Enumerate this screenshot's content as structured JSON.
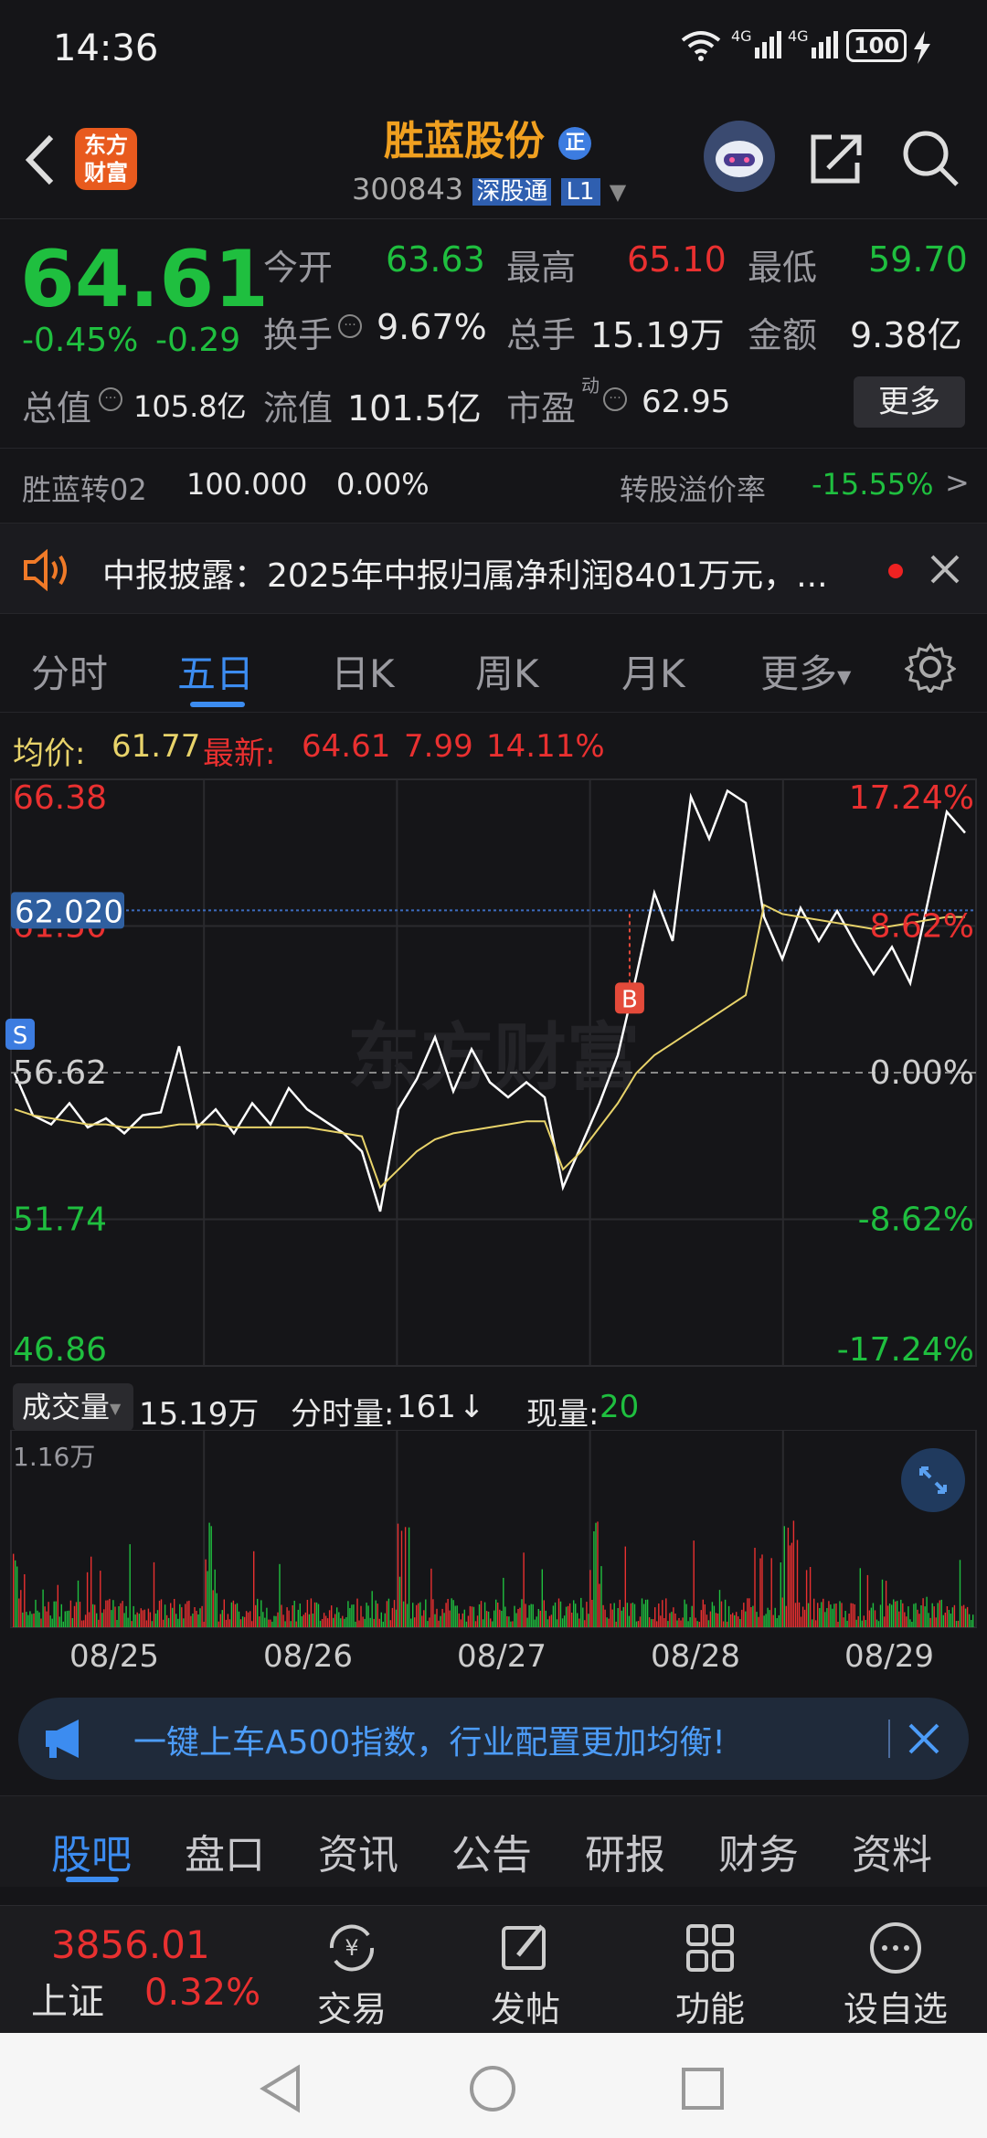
{
  "status": {
    "time": "14:36",
    "net1": "4G",
    "net2": "4G",
    "battery": "100"
  },
  "header": {
    "logo_line1": "东方",
    "logo_line2": "财富",
    "stock_name": "胜蓝股份",
    "name_badge": "正",
    "stock_code": "300843",
    "connect_badge": "深股通",
    "level_badge": "L1"
  },
  "quote": {
    "price": "64.61",
    "change_pct": "-0.45%",
    "change": "-0.29",
    "open_label": "今开",
    "open": "63.63",
    "high_label": "最高",
    "high": "65.10",
    "low_label": "最低",
    "low": "59.70",
    "turnover_label": "换手",
    "turnover": "9.67%",
    "volume_label": "总手",
    "volume": "15.19万",
    "amount_label": "金额",
    "amount": "9.38亿",
    "mktcap_label": "总值",
    "mktcap": "105.8亿",
    "float_label": "流值",
    "float_cap": "101.5亿",
    "pe_label": "市盈",
    "pe_sup": "动",
    "pe": "62.95",
    "more_button": "更多"
  },
  "bond": {
    "name": "胜蓝转02",
    "price": "100.000",
    "change": "0.00%",
    "premium_label": "转股溢价率",
    "premium": "-15.55%",
    "arrow": ">"
  },
  "notice": {
    "text": "中报披露：2025年中报归属净利润8401万元，..."
  },
  "chart_tabs": [
    "分时",
    "五日",
    "日K",
    "周K",
    "月K",
    "更多"
  ],
  "chart_info": {
    "avg_label": "均价:",
    "avg": "61.77",
    "latest_label": "最新:",
    "latest": "64.61",
    "chg": "7.99",
    "chg_pct": "14.11%"
  },
  "chart_data": {
    "type": "line",
    "title": "",
    "y_left_ticks": [
      "66.38",
      "61.50",
      "56.62",
      "51.74",
      "46.86"
    ],
    "y_right_ticks": [
      "17.24%",
      "8.62%",
      "0.00%",
      "-8.62%",
      "-17.24%"
    ],
    "ylim": [
      46.86,
      66.38
    ],
    "crosshair_price": "62.020",
    "baseline": 56.62,
    "markers": [
      {
        "label": "S",
        "day": "08/25"
      },
      {
        "label": "B",
        "day": "08/28"
      }
    ],
    "days": [
      "08/25",
      "08/26",
      "08/27",
      "08/28",
      "08/29"
    ],
    "watermark": "东方财富",
    "series": [
      {
        "name": "price",
        "color": "#ffffff",
        "values": [
          56.6,
          55.2,
          54.9,
          55.6,
          54.8,
          55.1,
          54.6,
          55.2,
          55.3,
          57.5,
          54.8,
          55.4,
          54.6,
          55.6,
          54.9,
          56.1,
          55.4,
          55.0,
          54.6,
          54.0,
          52.0,
          55.4,
          56.4,
          57.8,
          56.0,
          57.4,
          56.3,
          55.8,
          56.3,
          55.8,
          52.8,
          54.2,
          55.6,
          57.2,
          59.8,
          62.6,
          61.0,
          65.8,
          64.4,
          66.0,
          65.6,
          61.8,
          60.4,
          62.1,
          61.0,
          62.0,
          60.9,
          59.9,
          60.8,
          59.6,
          62.4,
          65.3,
          64.6
        ]
      },
      {
        "name": "avg",
        "color": "#e8d36a",
        "values": [
          55.4,
          55.2,
          55.1,
          55.0,
          54.9,
          54.9,
          54.8,
          54.8,
          54.8,
          54.9,
          54.9,
          54.9,
          54.8,
          54.8,
          54.8,
          54.8,
          54.8,
          54.7,
          54.6,
          54.5,
          52.8,
          53.4,
          54.0,
          54.4,
          54.6,
          54.7,
          54.8,
          54.9,
          55.0,
          55.0,
          53.4,
          54.0,
          54.8,
          55.6,
          56.6,
          57.2,
          57.6,
          58.0,
          58.4,
          58.8,
          59.2,
          62.2,
          61.9,
          61.8,
          61.7,
          61.6,
          61.5,
          61.4,
          61.5,
          61.6,
          61.7,
          61.8,
          61.8
        ]
      }
    ]
  },
  "volume": {
    "label": "成交量",
    "total": "15.19万",
    "min_label": "分时量:",
    "min_value": "161",
    "min_arrow": "↓",
    "now_label": "现量:",
    "now_value": "20",
    "max_tick": "1.16万"
  },
  "promo": {
    "text": "一键上车A500指数，行业配置更加均衡!"
  },
  "bottom_tabs": [
    "股吧",
    "盘口",
    "资讯",
    "公告",
    "研报",
    "财务",
    "资料"
  ],
  "toolbar": {
    "index_value": "3856.01",
    "index_name": "上证",
    "index_change": "0.32%",
    "trade": "交易",
    "post": "发帖",
    "func": "功能",
    "watch": "设自选"
  }
}
